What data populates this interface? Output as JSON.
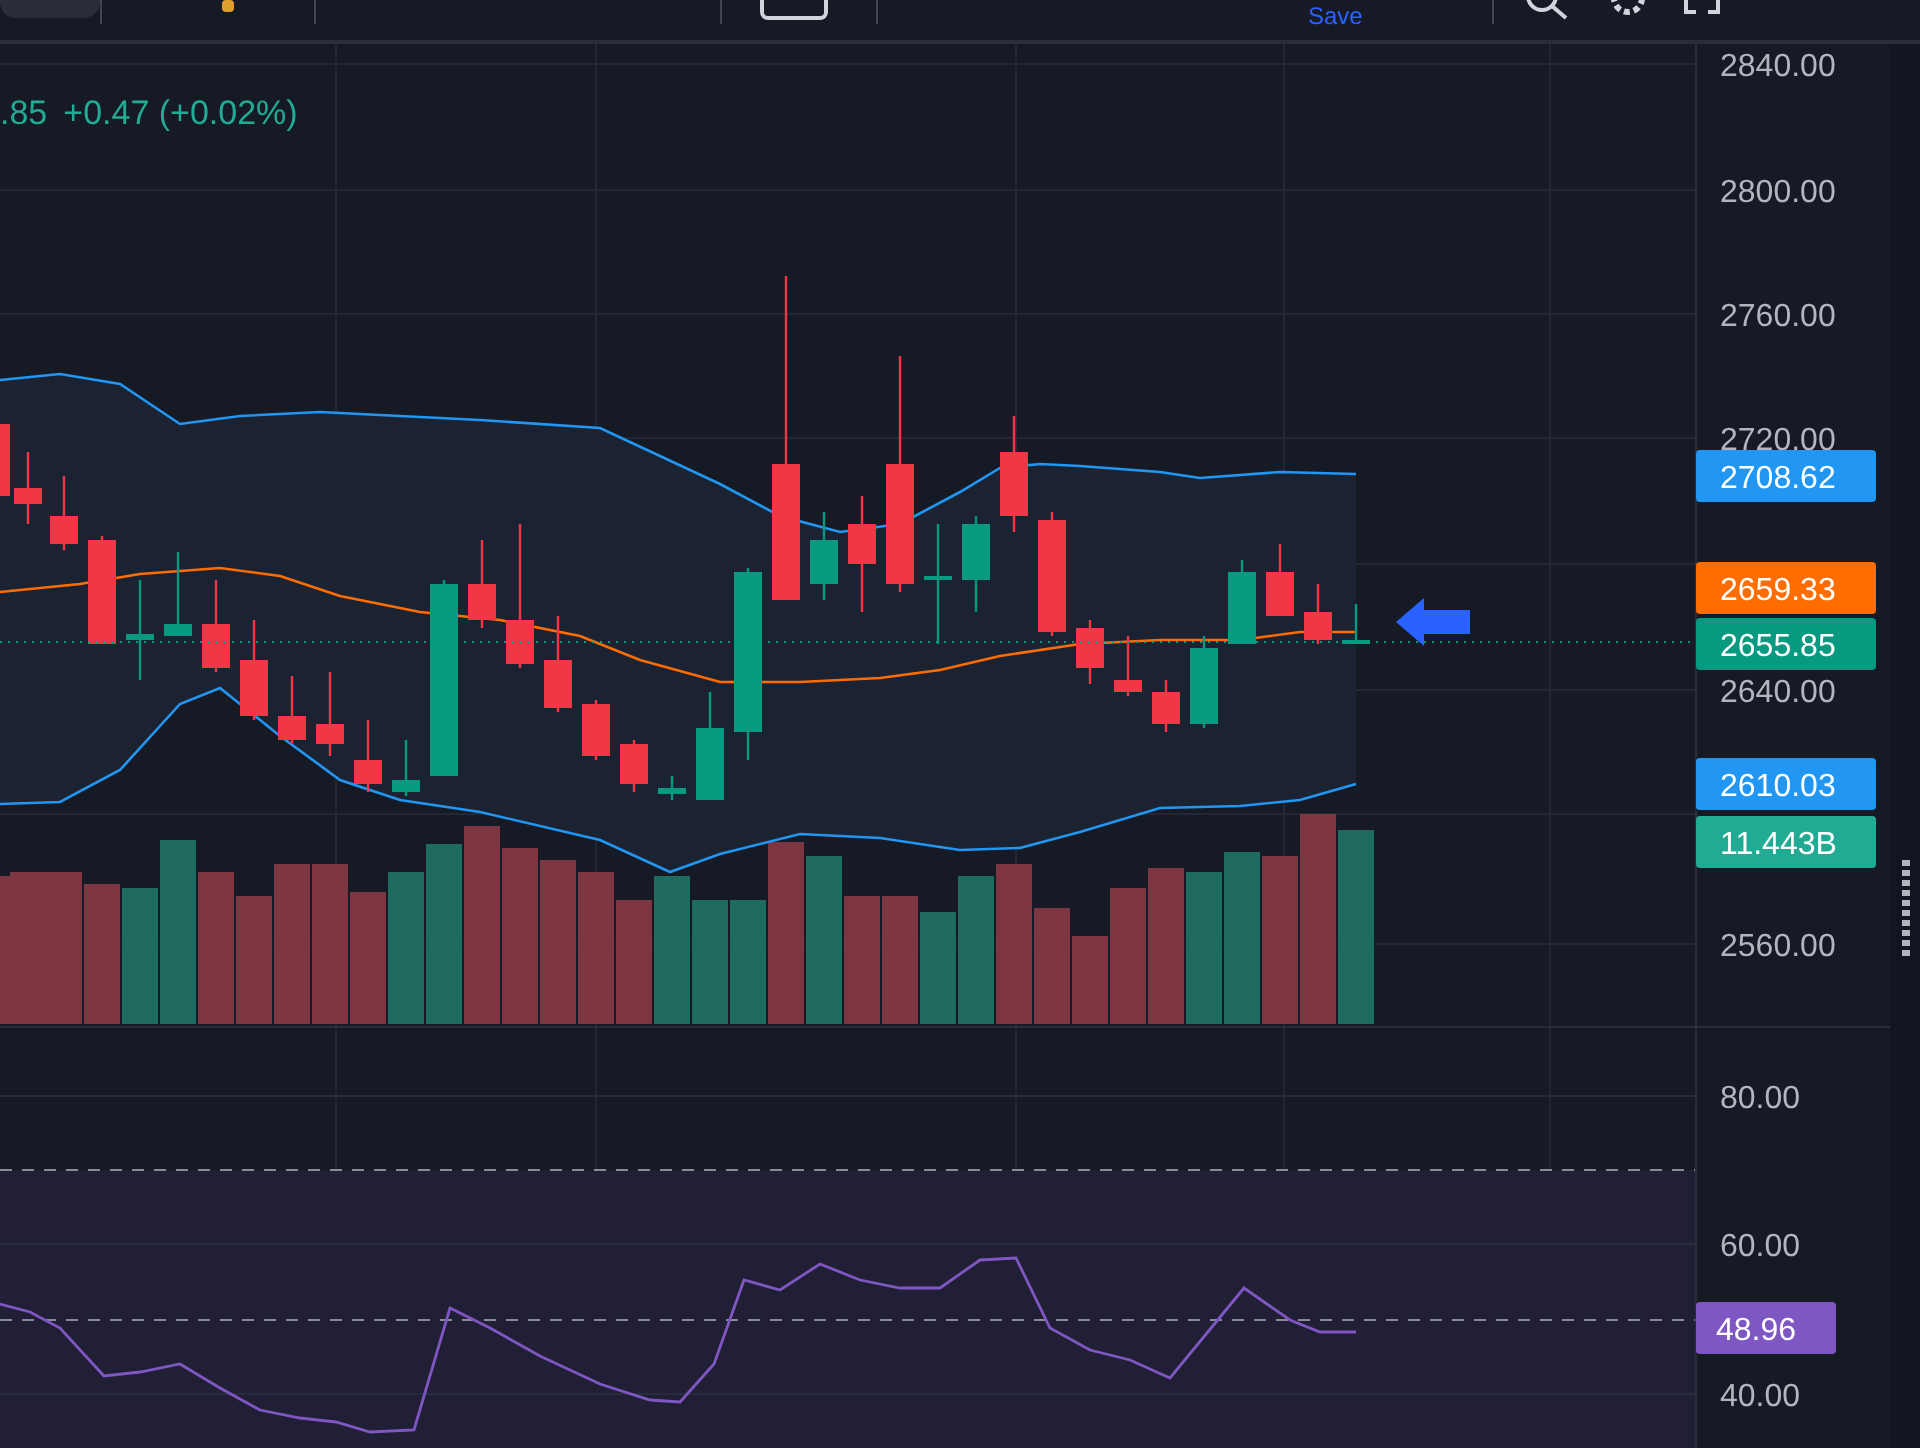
{
  "toolbar": {
    "save": "Save"
  },
  "price_pane": {
    "legend": {
      "last": ".85",
      "change": "+0.47 (+0.02%)"
    },
    "axis_ticks": [
      "2840.00",
      "2800.00",
      "2760.00",
      "2720.00",
      "2640.00",
      "2560.00"
    ],
    "price_labels": [
      {
        "text": "2708.62",
        "color": "#2196f3"
      },
      {
        "text": "2659.33",
        "color": "#ff6d00"
      },
      {
        "text": "2655.85",
        "color": "#089981"
      },
      {
        "text": "2610.03",
        "color": "#2196f3"
      },
      {
        "text": "11.443B",
        "color": "#22ab94"
      }
    ]
  },
  "rsi_pane": {
    "axis_ticks": [
      "80.00",
      "60.00",
      "40.00"
    ],
    "value_label": {
      "text": "48.96",
      "color": "#7e57c2"
    }
  }
}
